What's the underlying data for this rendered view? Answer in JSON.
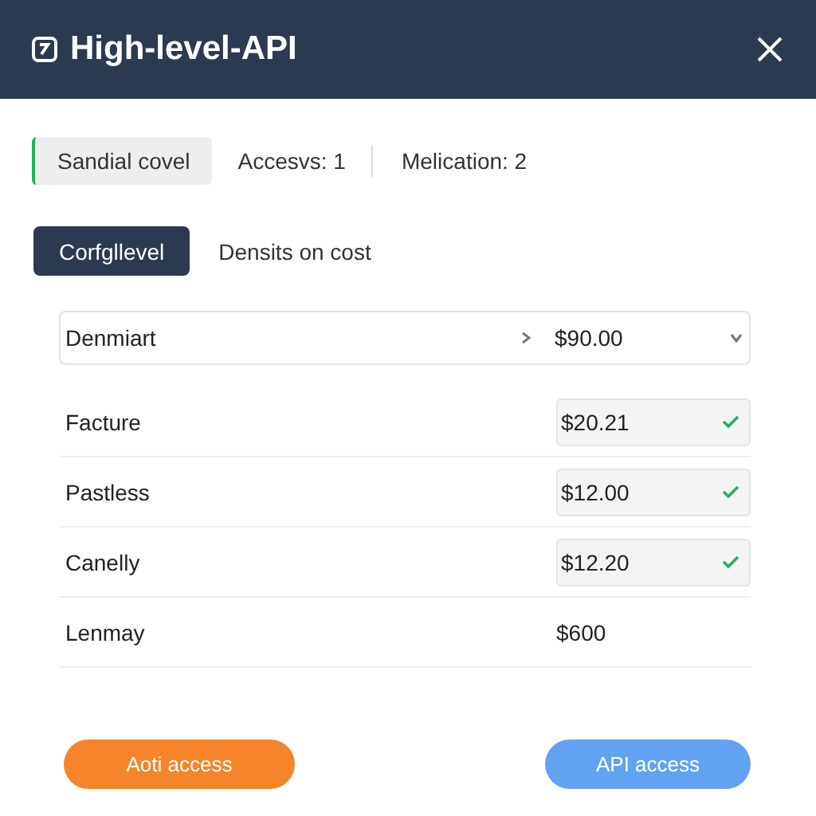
{
  "window": {
    "title": "High-level-API"
  },
  "tabs": [
    {
      "label": "Sandial covel",
      "selected": true
    },
    {
      "label": "Accesvs:  1",
      "selected": false
    },
    {
      "label": "Melication:  2",
      "selected": false
    }
  ],
  "modes": [
    {
      "label": "Corfgllevel",
      "selected": true
    },
    {
      "label": "Densits on cost",
      "selected": false
    }
  ],
  "rows": [
    {
      "kind": "select",
      "label": "Denmiart",
      "value": "$90.00"
    },
    {
      "kind": "field",
      "label": "Facture",
      "value": "$20.21",
      "checked": true
    },
    {
      "kind": "field",
      "label": "Pastless",
      "value": "$12.00",
      "checked": true
    },
    {
      "kind": "field",
      "label": "Canelly",
      "value": "$12.20",
      "checked": true
    },
    {
      "kind": "plain",
      "label": "Lenmay",
      "value": "$600"
    }
  ],
  "buttons": [
    {
      "label": "Aoti access",
      "color": "#f6842a"
    },
    {
      "label": "API access",
      "color": "#62a2f2"
    }
  ]
}
